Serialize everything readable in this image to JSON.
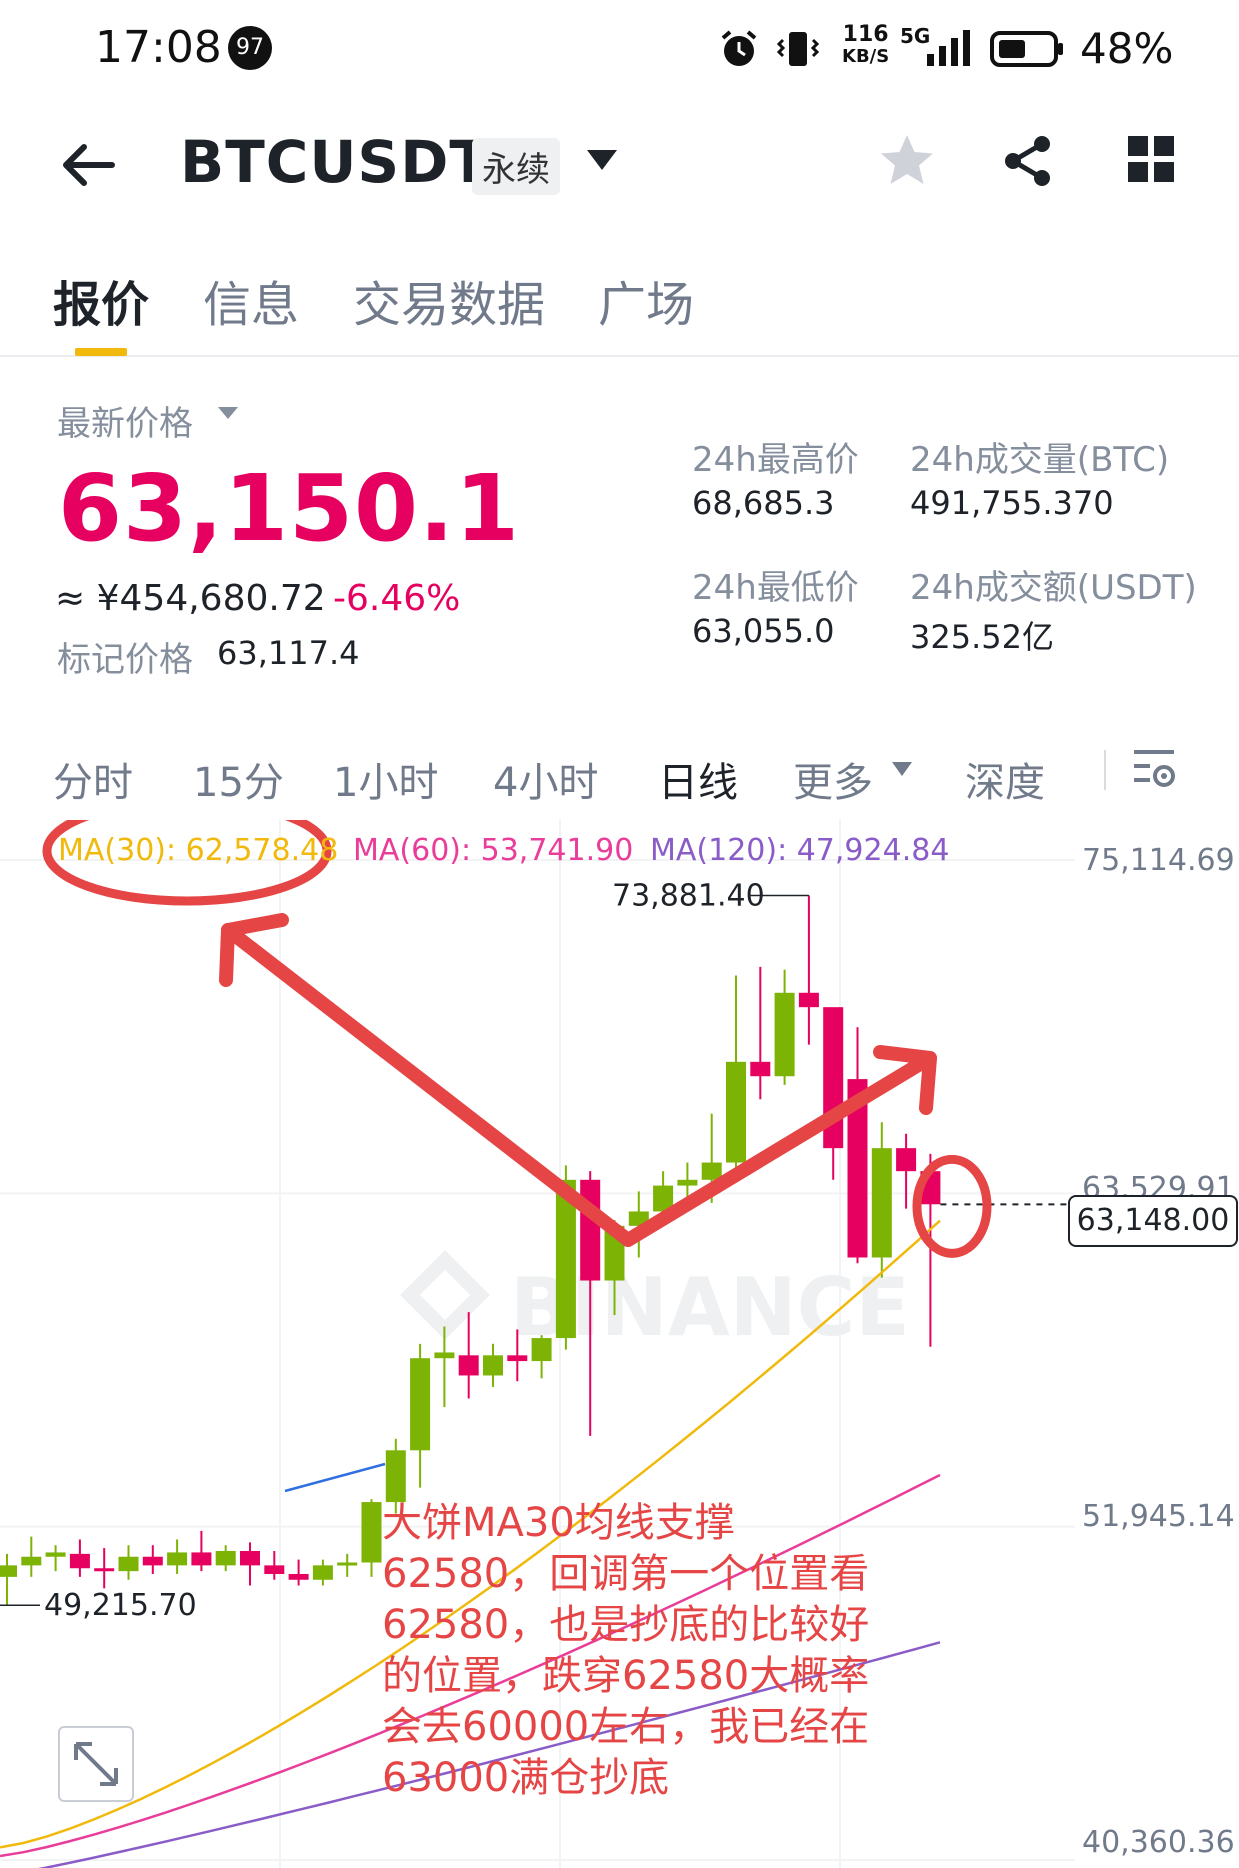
{
  "status_bar": {
    "time": "17:08",
    "notification_count": "97",
    "net_speed_value": "116",
    "net_speed_unit": "KB/S",
    "network": "5G",
    "battery": "48%"
  },
  "header": {
    "symbol": "BTCUSDT",
    "contract_type": "永续",
    "icons": [
      "back-arrow-icon",
      "chevron-down-icon",
      "star-icon",
      "share-icon",
      "grid-icon"
    ]
  },
  "tabs": [
    {
      "label": "报价",
      "active": true
    },
    {
      "label": "信息",
      "active": false
    },
    {
      "label": "交易数据",
      "active": false
    },
    {
      "label": "广场",
      "active": false
    }
  ],
  "price_panel": {
    "last_price_label": "最新价格",
    "last_price": "63,150.1",
    "cny_price": "≈ ¥454,680.72",
    "change_pct": "-6.46%",
    "mark_price_label": "标记价格",
    "mark_price": "63,117.4",
    "high_label": "24h最高价",
    "high_value": "68,685.3",
    "low_label": "24h最低价",
    "low_value": "63,055.0",
    "vol_btc_label": "24h成交量(BTC)",
    "vol_btc_value": "491,755.370",
    "vol_usdt_label": "24h成交额(USDT)",
    "vol_usdt_value": "325.52亿"
  },
  "timeframes": [
    {
      "label": "分时",
      "active": false
    },
    {
      "label": "15分",
      "active": false
    },
    {
      "label": "1小时",
      "active": false
    },
    {
      "label": "4小时",
      "active": false
    },
    {
      "label": "日线",
      "active": true
    },
    {
      "label": "更多",
      "active": false
    },
    {
      "label": "深度",
      "active": false
    }
  ],
  "chart": {
    "ma30": "MA(30): 62,578.48",
    "ma60": "MA(60): 53,741.90",
    "ma120": "MA(120): 47,924.84",
    "axis_top": "75,114.69",
    "axis_mid": "63,529.91",
    "axis_low": "51,945.14",
    "axis_bottom": "40,360.36",
    "high_marker": "73,881.40",
    "low_marker": "49,215.70",
    "current_price": "63,148.00",
    "watermark": "BINANCE",
    "colors": {
      "up": "#7cb305",
      "down": "#e6005f",
      "ma30": "#f0b90b",
      "ma60": "#e93d9a",
      "ma120": "#8a5cc8",
      "annotation": "#e64545"
    }
  },
  "annotation": {
    "lines": [
      "大饼MA30均线支撑",
      "62580，回调第一个位置看",
      "62580，也是抄底的比较好",
      "的位置，跌穿62580大概率",
      "会去60000左右，我已经在",
      "63000满仓抄底"
    ]
  },
  "chart_data": {
    "type": "candlestick",
    "price_axis_ticks": [
      75114.69,
      63529.91,
      51945.14,
      40360.36
    ],
    "ylim": [
      40360.36,
      75114.69
    ],
    "last_price": 63148.0,
    "ma_values": {
      "MA30": 62578.48,
      "MA60": 53741.9,
      "MA120": 47924.84
    },
    "marked_high": 73881.4,
    "marked_low": 49215.7,
    "candles": [
      {
        "o": 50200,
        "h": 51000,
        "l": 49215.7,
        "c": 50600
      },
      {
        "o": 50600,
        "h": 51600,
        "l": 50200,
        "c": 50900
      },
      {
        "o": 50900,
        "h": 51300,
        "l": 50400,
        "c": 51050
      },
      {
        "o": 51000,
        "h": 51500,
        "l": 50200,
        "c": 50500
      },
      {
        "o": 50500,
        "h": 51200,
        "l": 49800,
        "c": 50400
      },
      {
        "o": 50400,
        "h": 51300,
        "l": 50100,
        "c": 50900
      },
      {
        "o": 50900,
        "h": 51300,
        "l": 50300,
        "c": 50600
      },
      {
        "o": 50600,
        "h": 51500,
        "l": 50300,
        "c": 51050
      },
      {
        "o": 51050,
        "h": 51800,
        "l": 50400,
        "c": 50600
      },
      {
        "o": 50600,
        "h": 51300,
        "l": 50400,
        "c": 51100
      },
      {
        "o": 51100,
        "h": 51400,
        "l": 49900,
        "c": 50600
      },
      {
        "o": 50600,
        "h": 51100,
        "l": 50100,
        "c": 50300
      },
      {
        "o": 50300,
        "h": 50800,
        "l": 49900,
        "c": 50100
      },
      {
        "o": 50100,
        "h": 50800,
        "l": 49900,
        "c": 50600
      },
      {
        "o": 50600,
        "h": 51000,
        "l": 50200,
        "c": 50700
      },
      {
        "o": 50700,
        "h": 52900,
        "l": 50200,
        "c": 52800
      },
      {
        "o": 52800,
        "h": 55000,
        "l": 52400,
        "c": 54600
      },
      {
        "o": 54600,
        "h": 58300,
        "l": 53300,
        "c": 57800
      },
      {
        "o": 57800,
        "h": 58900,
        "l": 56100,
        "c": 58000
      },
      {
        "o": 57900,
        "h": 59400,
        "l": 56400,
        "c": 57200
      },
      {
        "o": 57200,
        "h": 58300,
        "l": 56800,
        "c": 57900
      },
      {
        "o": 57900,
        "h": 58800,
        "l": 57000,
        "c": 57700
      },
      {
        "o": 57700,
        "h": 58600,
        "l": 57100,
        "c": 58500
      },
      {
        "o": 58500,
        "h": 64500,
        "l": 58100,
        "c": 64000
      },
      {
        "o": 64000,
        "h": 64300,
        "l": 55100,
        "c": 60500
      },
      {
        "o": 60500,
        "h": 62600,
        "l": 59300,
        "c": 62400
      },
      {
        "o": 62400,
        "h": 63600,
        "l": 61300,
        "c": 62900
      },
      {
        "o": 62900,
        "h": 64300,
        "l": 62500,
        "c": 63800
      },
      {
        "o": 63800,
        "h": 64600,
        "l": 63000,
        "c": 64000
      },
      {
        "o": 64000,
        "h": 66300,
        "l": 63200,
        "c": 64600
      },
      {
        "o": 64600,
        "h": 71100,
        "l": 64000,
        "c": 68100
      },
      {
        "o": 68100,
        "h": 71400,
        "l": 66800,
        "c": 67600
      },
      {
        "o": 67600,
        "h": 71300,
        "l": 67300,
        "c": 70500
      },
      {
        "o": 70500,
        "h": 73881.4,
        "l": 68700,
        "c": 70000
      },
      {
        "o": 70000,
        "h": 67800,
        "l": 64000,
        "c": 65100
      },
      {
        "o": 67500,
        "h": 69300,
        "l": 61100,
        "c": 61300
      },
      {
        "o": 61300,
        "h": 66000,
        "l": 60600,
        "c": 65100
      },
      {
        "o": 65100,
        "h": 65600,
        "l": 63000,
        "c": 64300
      },
      {
        "o": 64300,
        "h": 64900,
        "l": 58200,
        "c": 63150
      }
    ]
  }
}
